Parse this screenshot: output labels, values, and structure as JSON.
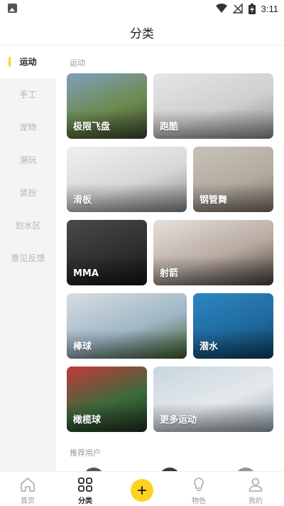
{
  "status_bar": {
    "time": "3:11"
  },
  "header": {
    "title": "分类"
  },
  "sidebar": {
    "items": [
      {
        "label": "运动",
        "active": true
      },
      {
        "label": "手工",
        "active": false
      },
      {
        "label": "宠物",
        "active": false
      },
      {
        "label": "潮玩",
        "active": false
      },
      {
        "label": "装扮",
        "active": false
      },
      {
        "label": "划水区",
        "active": false
      },
      {
        "label": "意见反馈",
        "active": false
      }
    ]
  },
  "main": {
    "section_title": "运动",
    "cards": [
      {
        "label": "极限飞盘",
        "colors": [
          "#7fa0bf",
          "#6c8a4e",
          "#3e4a2f"
        ]
      },
      {
        "label": "跑酷",
        "colors": [
          "#e6e6e6",
          "#cfcfcf",
          "#8e8e8e"
        ]
      },
      {
        "label": "滑板",
        "colors": [
          "#f0f0f0",
          "#d8d8d8",
          "#8c8c8c"
        ]
      },
      {
        "label": "钢管舞",
        "colors": [
          "#c9c2b8",
          "#b3aba0",
          "#7d736b"
        ]
      },
      {
        "label": "MMA",
        "colors": [
          "#4a4a4a",
          "#2f2f2f",
          "#151515"
        ]
      },
      {
        "label": "射箭",
        "colors": [
          "#e7e1dc",
          "#b7aaa1",
          "#4a3f3a"
        ]
      },
      {
        "label": "棒球",
        "colors": [
          "#d9dde0",
          "#9fb7c7",
          "#3f5f2e"
        ]
      },
      {
        "label": "潜水",
        "colors": [
          "#2f86c0",
          "#1e6a9f",
          "#0d3f63"
        ]
      },
      {
        "label": "橄榄球",
        "colors": [
          "#c23a3a",
          "#3b6a3b",
          "#20301f"
        ]
      },
      {
        "label": "更多运动",
        "colors": [
          "#c7d6df",
          "#e5e9ec",
          "#9aa7b0"
        ]
      }
    ],
    "recommend_title": "推荐用户",
    "avatars": [
      {
        "color": "#555555"
      },
      {
        "color": "#3a3a3a"
      },
      {
        "color": "#8a9a8a"
      }
    ]
  },
  "bottom_nav": {
    "items": [
      {
        "label": "首页",
        "icon": "home-icon",
        "active": false
      },
      {
        "label": "分类",
        "icon": "grid-icon",
        "active": true
      },
      {
        "label": "",
        "icon": "plus-icon",
        "active": false
      },
      {
        "label": "物色",
        "icon": "lightbulb-icon",
        "active": false
      },
      {
        "label": "我的",
        "icon": "person-icon",
        "active": false
      }
    ]
  },
  "colors": {
    "accent": "#ffd21f",
    "sidebar_bg": "#f4f4f4",
    "muted_text": "#9a9a9a"
  }
}
